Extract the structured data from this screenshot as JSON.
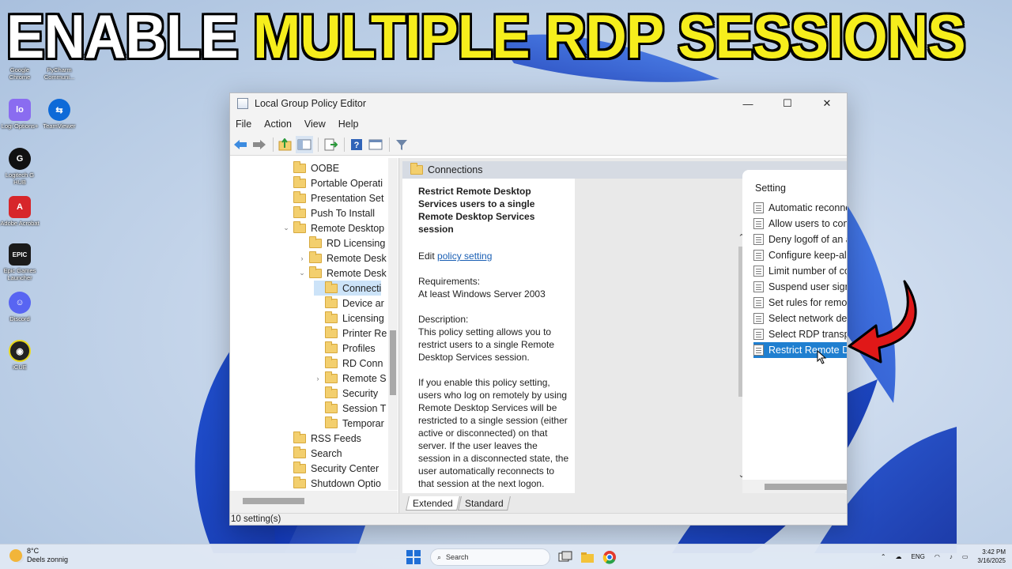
{
  "headline": {
    "part1": "ENABLE",
    "part2": "MULTIPLE RDP SESSIONS"
  },
  "desktop_icons": [
    {
      "label": "Google Chrome",
      "icon": "chrome-icon",
      "color": "#dadada"
    },
    {
      "label": "PyCharm Communi...",
      "icon": "pycharm-icon",
      "color": "#222222"
    },
    {
      "label": "Logi Options+",
      "icon": "logi-icon",
      "color": "#8a6cf0"
    },
    {
      "label": "TeamViewer",
      "icon": "teamviewer-icon",
      "color": "#0e6ad8"
    },
    {
      "label": "Logitech G HUB",
      "icon": "ghub-icon",
      "color": "#111111"
    },
    {
      "label": "Adobe Acrobat",
      "icon": "acrobat-icon",
      "color": "#d7262a"
    },
    {
      "label": "Epic Games Launcher",
      "icon": "epic-icon",
      "color": "#1b1b1b"
    },
    {
      "label": "Discord",
      "icon": "discord-icon",
      "color": "#5865f2"
    },
    {
      "label": "iCUE",
      "icon": "icue-icon",
      "color": "#222222"
    }
  ],
  "window": {
    "title": "Local Group Policy Editor",
    "menu": [
      "File",
      "Action",
      "View",
      "Help"
    ]
  },
  "tree": [
    {
      "label": "OOBE",
      "exp": "",
      "level": 0
    },
    {
      "label": "Portable Operati",
      "exp": "",
      "level": 0
    },
    {
      "label": "Presentation Set",
      "exp": "",
      "level": 0
    },
    {
      "label": "Push To Install",
      "exp": "",
      "level": 0
    },
    {
      "label": "Remote Desktop",
      "exp": "⌄",
      "level": 0
    },
    {
      "label": "RD Licensing",
      "exp": "",
      "level": 1
    },
    {
      "label": "Remote Desk",
      "exp": "›",
      "level": 1
    },
    {
      "label": "Remote Desk",
      "exp": "⌄",
      "level": 1
    },
    {
      "label": "Connecti",
      "exp": "",
      "level": 2,
      "selected": true
    },
    {
      "label": "Device ar",
      "exp": "",
      "level": 2
    },
    {
      "label": "Licensing",
      "exp": "",
      "level": 2
    },
    {
      "label": "Printer Re",
      "exp": "",
      "level": 2
    },
    {
      "label": "Profiles",
      "exp": "",
      "level": 2
    },
    {
      "label": "RD Conn",
      "exp": "",
      "level": 2
    },
    {
      "label": "Remote S",
      "exp": "›",
      "level": 2
    },
    {
      "label": "Security",
      "exp": "",
      "level": 2
    },
    {
      "label": "Session T",
      "exp": "",
      "level": 2
    },
    {
      "label": "Temporar",
      "exp": "",
      "level": 2
    },
    {
      "label": "RSS Feeds",
      "exp": "",
      "level": 0
    },
    {
      "label": "Search",
      "exp": "",
      "level": 0
    },
    {
      "label": "Security Center",
      "exp": "",
      "level": 0
    },
    {
      "label": "Shutdown Optio",
      "exp": "",
      "level": 0
    }
  ],
  "pane": {
    "header": "Connections",
    "desc_title": "Restrict Remote Desktop Services users to a single Remote Desktop Services session",
    "edit_prefix": "Edit ",
    "edit_link": "policy setting",
    "req_label": "Requirements:",
    "req_value": "At least Windows Server 2003",
    "desc_label": "Description:",
    "desc_p1": "This policy setting allows you to restrict users to a single Remote Desktop Services session.",
    "desc_p2": "If you enable this policy setting, users who log on remotely by using Remote Desktop Services will be restricted to a single session (either active or disconnected) on that server. If the user leaves the session in a disconnected state, the user automatically reconnects to that session at the next logon."
  },
  "settings": {
    "header": "Setting",
    "items": [
      "Automatic reconnection",
      "Allow users to connect remotely by using Remote Desktop",
      "Deny logoff of an administrator logged in to the console s",
      "Configure keep-alive connection interval",
      "Limit number of connections",
      "Suspend user sign-in to complete app registration",
      "Set rules for remote control of Remote Desktop Services us",
      "Select network detection on the server",
      "Select RDP transport protocols",
      "Restrict Remote Desktop Services users to a single Remote"
    ],
    "selected_index": 9
  },
  "tabs": {
    "extended": "Extended",
    "standard": "Standard"
  },
  "status": "10 setting(s)",
  "taskbar": {
    "temp": "8°C",
    "weather": "Deels zonnig",
    "search": "Search",
    "lang": "ENG",
    "time": "3:42 PM",
    "date": "3/16/2025"
  },
  "colors": {
    "headline_yellow": "#f6ee1c",
    "selection_blue": "#1f7fd0",
    "arrow_red": "#e01818"
  }
}
